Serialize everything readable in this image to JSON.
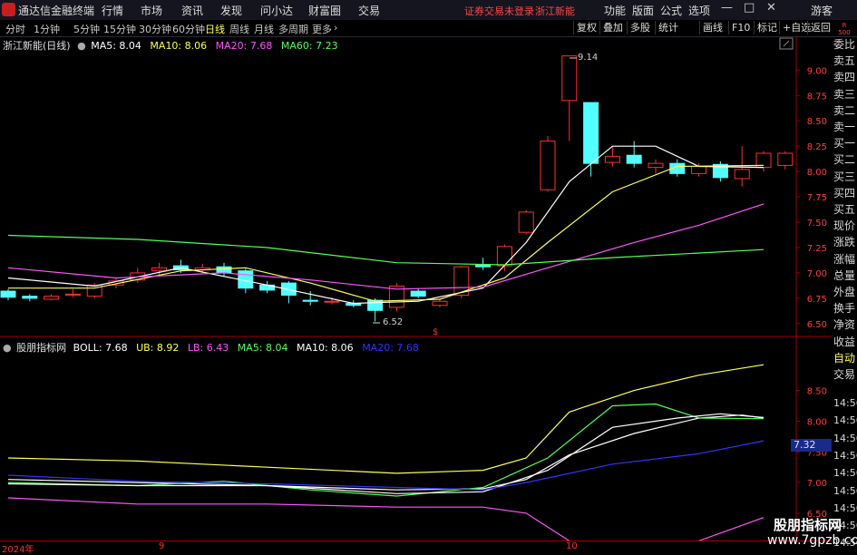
{
  "menubar": {
    "app_name": "通达信金融终端",
    "menus": [
      "行情",
      "市场",
      "资讯",
      "发现",
      "问小达",
      "财富圈",
      "交易"
    ],
    "warning": "证券交易未登录",
    "stock_name_top": "浙江新能",
    "right_menus": [
      "功能",
      "版面",
      "公式",
      "选项"
    ],
    "guest": "游客",
    "win_min": "—",
    "win_max": "□",
    "win_close": "✕"
  },
  "tabbar": {
    "tabs": [
      "分时",
      "1分钟",
      "5分钟",
      "15分钟",
      "30分钟",
      "60分钟",
      "日线",
      "周线",
      "月线",
      "多周期",
      "更多"
    ],
    "active_tab": "日线",
    "more_arrow": "›",
    "right_buttons": [
      "复权",
      "叠加",
      "多股",
      "统计",
      "画线",
      "F10",
      "标记",
      "+自选",
      "返回"
    ]
  },
  "main_chart": {
    "title": "浙江新能(日线)",
    "ma_legend": [
      {
        "label": "MA5: 8.04",
        "color": "#ffffff"
      },
      {
        "label": "MA10: 8.06",
        "color": "#ffff55"
      },
      {
        "label": "MA20: 7.68",
        "color": "#ff55ff"
      },
      {
        "label": "MA60: 7.23",
        "color": "#55ff55"
      }
    ],
    "high_label": "9.14",
    "low_label": "6.52",
    "marker": "$"
  },
  "indicator": {
    "title": "股朋指标网",
    "legend": [
      {
        "label": "BOLL: 7.68",
        "color": "#ffffff"
      },
      {
        "label": "UB: 8.92",
        "color": "#ffff55"
      },
      {
        "label": "LB: 6.43",
        "color": "#ff55ff"
      },
      {
        "label": "MA5: 8.04",
        "color": "#55ff55"
      },
      {
        "label": "MA10: 8.06",
        "color": "#ffffff"
      },
      {
        "label": "MA20: 7.68",
        "color": "#3333ff"
      }
    ],
    "current_badge": "7.32"
  },
  "sidebar": {
    "rb_label": "R",
    "rb_value": "500",
    "items": [
      "委比",
      "卖五",
      "卖四",
      "卖三",
      "卖二",
      "卖一",
      "买一",
      "买二",
      "买三",
      "买四",
      "买五",
      "现价",
      "涨跌",
      "涨幅",
      "总量",
      "外盘",
      "换手",
      "净资",
      "收益",
      "自动",
      "交易"
    ],
    "times": [
      "14:56",
      "14:56",
      "14:56",
      "14:56",
      "14:56",
      "14:56",
      "14:56",
      "14:56",
      "14:56"
    ]
  },
  "footer": {
    "dates": [
      "2024年",
      "9",
      "10"
    ]
  },
  "watermark": {
    "line1": "股朋指标网",
    "line2": "www.7gpzb.com"
  },
  "chart_data": [
    {
      "type": "candlestick",
      "title": "浙江新能(日线)",
      "yticks": [
        6.5,
        6.75,
        7.0,
        7.25,
        7.5,
        7.75,
        8.0,
        8.25,
        8.5,
        8.75,
        9.0
      ],
      "ylim": [
        6.4,
        9.28
      ],
      "candles": [
        {
          "o": 6.82,
          "c": 6.76,
          "h": 6.84,
          "l": 6.73
        },
        {
          "o": 6.77,
          "c": 6.75,
          "h": 6.79,
          "l": 6.72
        },
        {
          "o": 6.74,
          "c": 6.77,
          "h": 6.79,
          "l": 6.73
        },
        {
          "o": 6.79,
          "c": 6.79,
          "h": 6.84,
          "l": 6.76
        },
        {
          "o": 6.77,
          "c": 6.88,
          "h": 6.9,
          "l": 6.75
        },
        {
          "o": 6.88,
          "c": 6.92,
          "h": 6.95,
          "l": 6.85
        },
        {
          "o": 6.93,
          "c": 7.0,
          "h": 7.05,
          "l": 6.9
        },
        {
          "o": 7.02,
          "c": 7.05,
          "h": 7.1,
          "l": 6.98
        },
        {
          "o": 7.07,
          "c": 7.03,
          "h": 7.13,
          "l": 7.0
        },
        {
          "o": 7.03,
          "c": 7.05,
          "h": 7.09,
          "l": 7.0
        },
        {
          "o": 7.06,
          "c": 7.0,
          "h": 7.1,
          "l": 6.97
        },
        {
          "o": 7.02,
          "c": 6.85,
          "h": 7.04,
          "l": 6.8
        },
        {
          "o": 6.88,
          "c": 6.83,
          "h": 6.92,
          "l": 6.8
        },
        {
          "o": 6.9,
          "c": 6.78,
          "h": 6.92,
          "l": 6.7
        },
        {
          "o": 6.73,
          "c": 6.72,
          "h": 6.82,
          "l": 6.68
        },
        {
          "o": 6.72,
          "c": 6.72,
          "h": 6.76,
          "l": 6.69
        },
        {
          "o": 6.7,
          "c": 6.68,
          "h": 6.73,
          "l": 6.66
        },
        {
          "o": 6.73,
          "c": 6.63,
          "h": 6.75,
          "l": 6.52
        },
        {
          "o": 6.66,
          "c": 6.87,
          "h": 6.9,
          "l": 6.62
        },
        {
          "o": 6.82,
          "c": 6.77,
          "h": 6.85,
          "l": 6.75
        },
        {
          "o": 6.68,
          "c": 6.72,
          "h": 6.75,
          "l": 6.66
        },
        {
          "o": 6.78,
          "c": 7.06,
          "h": 7.07,
          "l": 6.75
        },
        {
          "o": 7.08,
          "c": 7.06,
          "h": 7.15,
          "l": 7.03
        },
        {
          "o": 7.07,
          "c": 7.26,
          "h": 7.28,
          "l": 7.02
        },
        {
          "o": 7.4,
          "c": 7.6,
          "h": 7.62,
          "l": 7.38
        },
        {
          "o": 7.82,
          "c": 8.3,
          "h": 8.35,
          "l": 7.8
        },
        {
          "o": 8.7,
          "c": 9.14,
          "h": 9.14,
          "l": 8.3
        },
        {
          "o": 8.68,
          "c": 8.08,
          "h": 8.68,
          "l": 7.95
        },
        {
          "o": 8.09,
          "c": 8.15,
          "h": 8.25,
          "l": 8.05
        },
        {
          "o": 8.16,
          "c": 8.08,
          "h": 8.3,
          "l": 8.04
        },
        {
          "o": 8.04,
          "c": 8.08,
          "h": 8.12,
          "l": 7.98
        },
        {
          "o": 8.08,
          "c": 7.98,
          "h": 8.12,
          "l": 7.95
        },
        {
          "o": 7.98,
          "c": 8.05,
          "h": 8.08,
          "l": 7.95
        },
        {
          "o": 8.07,
          "c": 7.94,
          "h": 8.1,
          "l": 7.9
        },
        {
          "o": 7.93,
          "c": 8.02,
          "h": 8.25,
          "l": 7.85
        },
        {
          "o": 8.04,
          "c": 8.18,
          "h": 8.2,
          "l": 8.0
        },
        {
          "o": 8.06,
          "c": 8.18,
          "h": 8.2,
          "l": 8.02
        }
      ],
      "series": [
        {
          "name": "MA5",
          "color": "#ffffff",
          "points": [
            [
              0,
              6.95
            ],
            [
              4,
              6.87
            ],
            [
              8,
              7.05
            ],
            [
              12,
              6.88
            ],
            [
              16,
              6.7
            ],
            [
              19,
              6.72
            ],
            [
              22,
              6.85
            ],
            [
              24,
              7.3
            ],
            [
              26,
              7.9
            ],
            [
              28,
              8.25
            ],
            [
              30,
              8.25
            ],
            [
              32,
              8.05
            ],
            [
              35,
              8.04
            ]
          ]
        },
        {
          "name": "MA10",
          "color": "#ffff55",
          "points": [
            [
              0,
              6.85
            ],
            [
              4,
              6.85
            ],
            [
              8,
              7.02
            ],
            [
              11,
              7.05
            ],
            [
              14,
              6.9
            ],
            [
              17,
              6.72
            ],
            [
              20,
              6.74
            ],
            [
              23,
              6.95
            ],
            [
              25,
              7.3
            ],
            [
              28,
              7.8
            ],
            [
              31,
              8.05
            ],
            [
              35,
              8.06
            ]
          ]
        },
        {
          "name": "MA20",
          "color": "#ff55ff",
          "points": [
            [
              0,
              7.05
            ],
            [
              5,
              6.95
            ],
            [
              10,
              7.0
            ],
            [
              14,
              6.93
            ],
            [
              18,
              6.84
            ],
            [
              22,
              6.86
            ],
            [
              25,
              7.05
            ],
            [
              29,
              7.3
            ],
            [
              32,
              7.47
            ],
            [
              35,
              7.68
            ]
          ]
        },
        {
          "name": "MA60",
          "color": "#55ff55",
          "points": [
            [
              0,
              7.37
            ],
            [
              6,
              7.33
            ],
            [
              12,
              7.25
            ],
            [
              18,
              7.1
            ],
            [
              23,
              7.08
            ],
            [
              28,
              7.15
            ],
            [
              35,
              7.23
            ]
          ]
        }
      ]
    },
    {
      "type": "line",
      "title": "股朋指标网",
      "yticks": [
        6.5,
        7.0,
        7.5,
        8.0,
        8.5
      ],
      "ylim": [
        6.1,
        9.1
      ],
      "series": [
        {
          "name": "UB",
          "color": "#ffff55",
          "points": [
            [
              0,
              7.4
            ],
            [
              6,
              7.35
            ],
            [
              12,
              7.25
            ],
            [
              18,
              7.15
            ],
            [
              22,
              7.2
            ],
            [
              24,
              7.4
            ],
            [
              26,
              8.15
            ],
            [
              29,
              8.5
            ],
            [
              32,
              8.75
            ],
            [
              35,
              8.92
            ]
          ]
        },
        {
          "name": "BOLL",
          "color": "#ffffff",
          "points": [
            [
              0,
              7.05
            ],
            [
              6,
              7.0
            ],
            [
              12,
              6.95
            ],
            [
              18,
              6.88
            ],
            [
              22,
              6.9
            ],
            [
              24,
              7.05
            ],
            [
              26,
              7.45
            ],
            [
              29,
              7.8
            ],
            [
              32,
              8.05
            ],
            [
              34,
              8.1
            ],
            [
              35,
              8.05
            ]
          ]
        },
        {
          "name": "LB",
          "color": "#ff55ff",
          "points": [
            [
              0,
              6.75
            ],
            [
              6,
              6.65
            ],
            [
              12,
              6.65
            ],
            [
              18,
              6.6
            ],
            [
              22,
              6.6
            ],
            [
              24,
              6.5
            ],
            [
              26,
              6.05
            ],
            [
              29,
              5.95
            ],
            [
              32,
              6.05
            ],
            [
              35,
              6.43
            ]
          ]
        },
        {
          "name": "MA5",
          "color": "#55ff55",
          "points": [
            [
              0,
              7.0
            ],
            [
              6,
              6.95
            ],
            [
              10,
              7.02
            ],
            [
              14,
              6.88
            ],
            [
              18,
              6.78
            ],
            [
              22,
              6.92
            ],
            [
              25,
              7.4
            ],
            [
              28,
              8.25
            ],
            [
              30,
              8.28
            ],
            [
              32,
              8.05
            ],
            [
              35,
              8.04
            ]
          ]
        },
        {
          "name": "MA10",
          "color": "#ffffff",
          "points": [
            [
              0,
              6.98
            ],
            [
              6,
              6.95
            ],
            [
              12,
              6.95
            ],
            [
              18,
              6.82
            ],
            [
              22,
              6.85
            ],
            [
              25,
              7.2
            ],
            [
              28,
              7.9
            ],
            [
              31,
              8.05
            ],
            [
              33,
              8.12
            ],
            [
              35,
              8.06
            ]
          ]
        },
        {
          "name": "MA20",
          "color": "#3333ff",
          "points": [
            [
              0,
              7.12
            ],
            [
              6,
              7.02
            ],
            [
              12,
              6.98
            ],
            [
              18,
              6.92
            ],
            [
              22,
              6.88
            ],
            [
              24,
              7.0
            ],
            [
              28,
              7.3
            ],
            [
              32,
              7.47
            ],
            [
              35,
              7.68
            ]
          ]
        }
      ]
    }
  ]
}
